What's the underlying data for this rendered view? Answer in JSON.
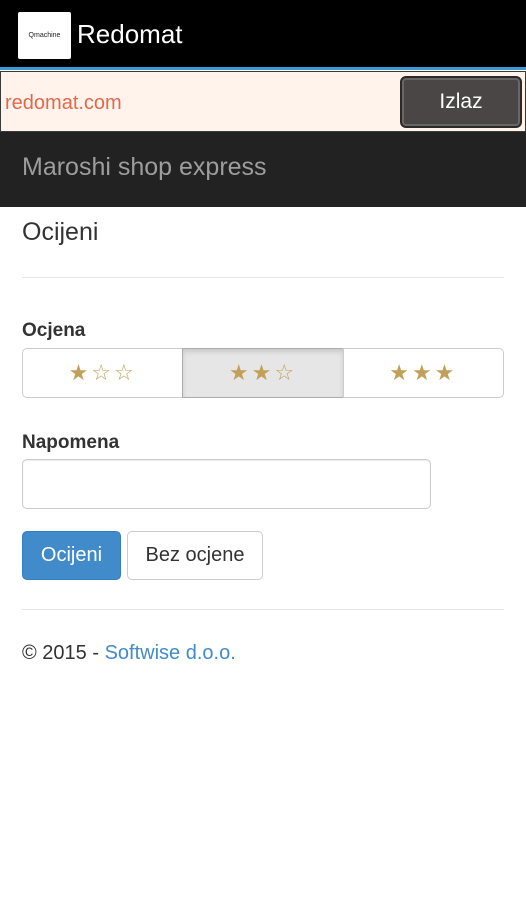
{
  "app": {
    "logo_text": "Qmachine",
    "title": "Redomat"
  },
  "urlbar": {
    "url": "redomat.com",
    "exit_label": "Izlaz"
  },
  "navbar": {
    "brand": "Maroshi shop express"
  },
  "main": {
    "title": "Ocijeni",
    "rating_label": "Ocjena",
    "rating_options": [
      {
        "stars": "★☆☆",
        "value": 1,
        "selected": false
      },
      {
        "stars": "★★☆",
        "value": 2,
        "selected": true
      },
      {
        "stars": "★★★",
        "value": 3,
        "selected": false
      }
    ],
    "note_label": "Napomena",
    "note_value": "",
    "submit_label": "Ocijeni",
    "skip_label": "Bez ocjene"
  },
  "footer": {
    "copyright": "© 2015 -",
    "company": "Softwise d.o.o."
  },
  "colors": {
    "appbar": "#000000",
    "accent_line": "#3a9bd9",
    "url_text": "#e2684c",
    "star": "#c2a05a",
    "primary": "#428bca",
    "link": "#428bca"
  }
}
